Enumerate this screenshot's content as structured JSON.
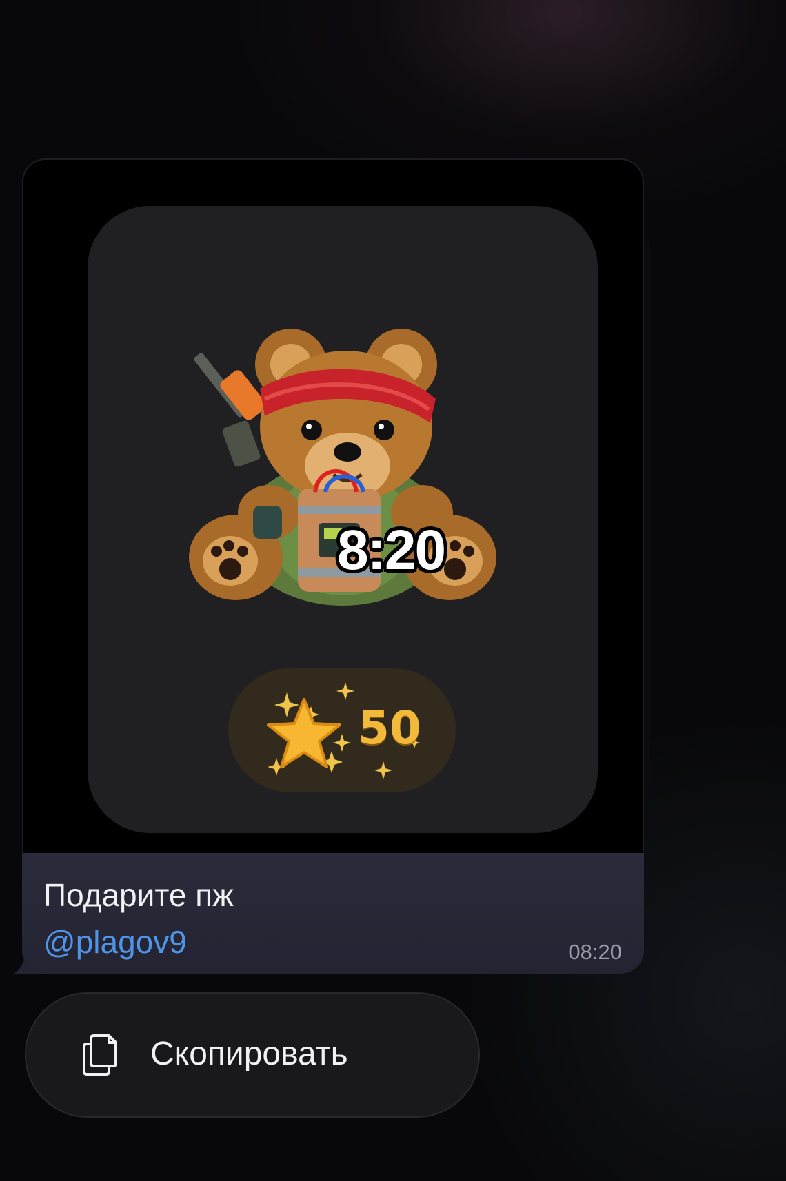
{
  "message": {
    "gift": {
      "timer": "8:20",
      "price_stars": "50",
      "sticker_icon": "teddy-bear-sticker",
      "currency_icon": "star-icon"
    },
    "caption_text": "Подарите пж",
    "mention": "@plagov9",
    "time": "08:20"
  },
  "context_menu": {
    "copy_label": "Скопировать",
    "copy_icon": "copy-icon"
  },
  "colors": {
    "mention": "#4f94e6",
    "star_gold": "#f2b93a",
    "caption_bg": "#2b2b3b"
  }
}
